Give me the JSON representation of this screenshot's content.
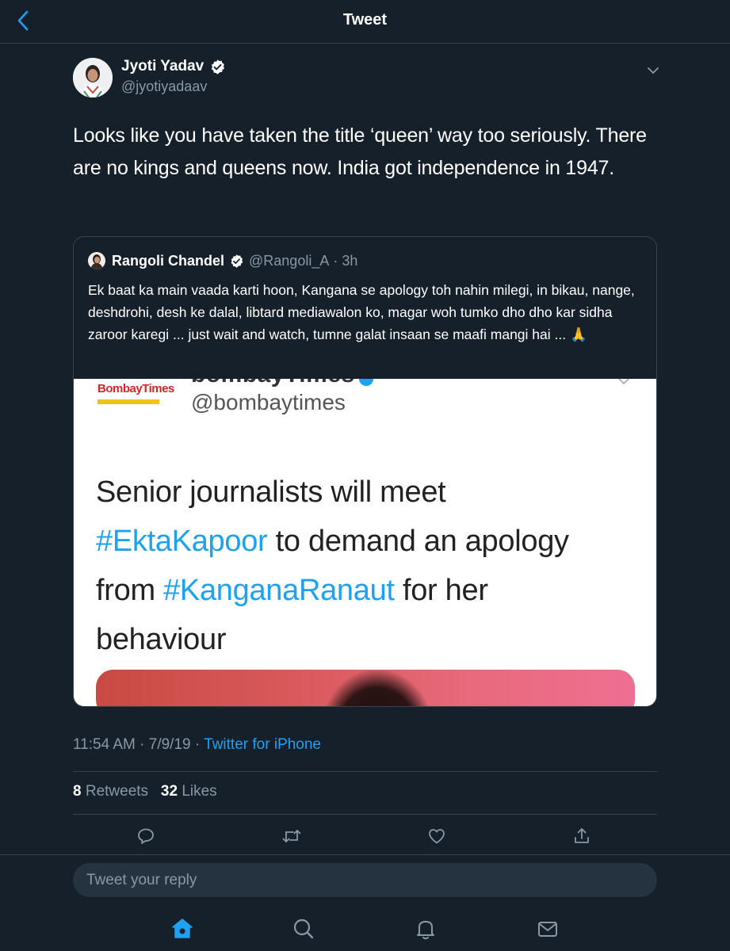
{
  "header": {
    "title": "Tweet"
  },
  "tweet": {
    "author_name": "Jyoti Yadav",
    "author_handle": "@jyotiyadaav",
    "text": "Looks like you have taken the title ‘queen’ way too seriously. There are no kings and queens now. India got independence in 1947.",
    "time": "11:54 AM",
    "date": "7/9/19",
    "source": "Twitter for iPhone",
    "retweets": "8",
    "retweets_label": "Retweets",
    "likes": "32",
    "likes_label": "Likes"
  },
  "quote": {
    "author_name": "Rangoli Chandel",
    "author_handle": "@Rangoli_A",
    "age": "3h",
    "text": "Ek baat ka main vaada karti hoon, Kangana se apology toh nahin milegi, in bikau, nange, deshdrohi, desh ke dalal, libtard mediawalon ko, magar woh tumko dho dho kar sidha zaroor karegi ... just wait and watch, tumne galat insaan se maafi mangi hai ... 🙏",
    "image": {
      "logo_text": "BombayTimes",
      "top_cut_text": "bombayTimes",
      "handle": "@bombaytimes",
      "line1": "Senior journalists will meet",
      "hashtag1": "#EktaKapoor",
      "line2_rest": " to demand an apology",
      "line3_start": "from ",
      "hashtag2": "#KanganaRanaut",
      "line3_rest": " for her",
      "line4": "behaviour"
    }
  },
  "reply": {
    "placeholder": "Tweet your reply"
  },
  "colors": {
    "background": "#15202b",
    "accent": "#1da1f2",
    "muted": "#8899a6",
    "border": "#38444d"
  },
  "icons": {
    "back": "chevron-left-icon",
    "verified": "verified-badge-icon",
    "caret": "chevron-down-icon",
    "reply": "comment-icon",
    "retweet": "retweet-icon",
    "like": "heart-icon",
    "share": "share-icon",
    "home": "home-icon",
    "search": "search-icon",
    "notifications": "bell-icon",
    "messages": "mail-icon"
  }
}
